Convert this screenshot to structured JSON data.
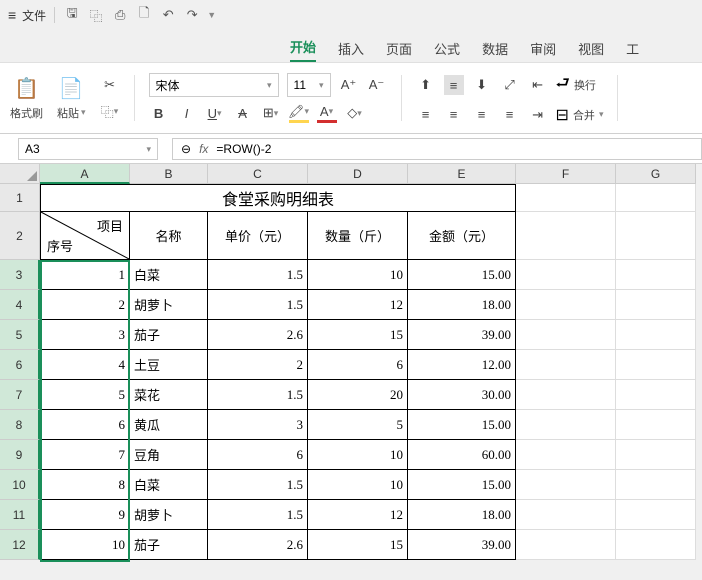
{
  "menubar": {
    "file": "文件"
  },
  "tabs": {
    "start": "开始",
    "insert": "插入",
    "page": "页面",
    "formula": "公式",
    "data": "数据",
    "review": "审阅",
    "view": "视图",
    "tools": "工"
  },
  "ribbon": {
    "format_painter": "格式刷",
    "paste": "粘贴",
    "font_name": "宋体",
    "font_size": "11",
    "wrap": "换行",
    "merge": "合并"
  },
  "name_box": "A3",
  "formula": "=ROW()-2",
  "colHeaders": [
    "A",
    "B",
    "C",
    "D",
    "E",
    "F",
    "G"
  ],
  "rowHeaders": [
    1,
    2,
    3,
    4,
    5,
    6,
    7,
    8,
    9,
    10,
    11,
    12
  ],
  "title": "食堂采购明细表",
  "header": {
    "diag_top": "项目",
    "diag_bottom": "序号",
    "b": "名称",
    "c": "单价（元）",
    "d": "数量（斤）",
    "e": "金额（元）"
  },
  "rows": [
    {
      "a": "1",
      "b": "白菜",
      "c": "1.5",
      "d": "10",
      "e": "15.00"
    },
    {
      "a": "2",
      "b": "胡萝卜",
      "c": "1.5",
      "d": "12",
      "e": "18.00"
    },
    {
      "a": "3",
      "b": "茄子",
      "c": "2.6",
      "d": "15",
      "e": "39.00"
    },
    {
      "a": "4",
      "b": "土豆",
      "c": "2",
      "d": "6",
      "e": "12.00"
    },
    {
      "a": "5",
      "b": "菜花",
      "c": "1.5",
      "d": "20",
      "e": "30.00"
    },
    {
      "a": "6",
      "b": "黄瓜",
      "c": "3",
      "d": "5",
      "e": "15.00"
    },
    {
      "a": "7",
      "b": "豆角",
      "c": "6",
      "d": "10",
      "e": "60.00"
    },
    {
      "a": "8",
      "b": "白菜",
      "c": "1.5",
      "d": "10",
      "e": "15.00"
    },
    {
      "a": "9",
      "b": "胡萝卜",
      "c": "1.5",
      "d": "12",
      "e": "18.00"
    },
    {
      "a": "10",
      "b": "茄子",
      "c": "2.6",
      "d": "15",
      "e": "39.00"
    }
  ],
  "chart_data": {
    "type": "table",
    "title": "食堂采购明细表",
    "columns": [
      "序号",
      "名称",
      "单价（元）",
      "数量（斤）",
      "金额（元）"
    ],
    "rows": [
      [
        1,
        "白菜",
        1.5,
        10,
        15.0
      ],
      [
        2,
        "胡萝卜",
        1.5,
        12,
        18.0
      ],
      [
        3,
        "茄子",
        2.6,
        15,
        39.0
      ],
      [
        4,
        "土豆",
        2,
        6,
        12.0
      ],
      [
        5,
        "菜花",
        1.5,
        20,
        30.0
      ],
      [
        6,
        "黄瓜",
        3,
        5,
        15.0
      ],
      [
        7,
        "豆角",
        6,
        10,
        60.0
      ],
      [
        8,
        "白菜",
        1.5,
        10,
        15.0
      ],
      [
        9,
        "胡萝卜",
        1.5,
        12,
        18.0
      ],
      [
        10,
        "茄子",
        2.6,
        15,
        39.0
      ]
    ]
  }
}
